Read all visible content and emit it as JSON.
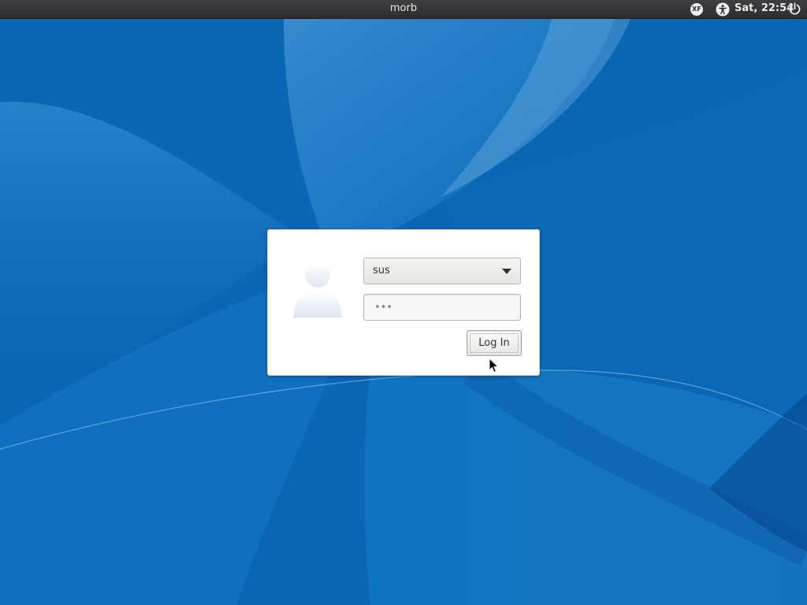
{
  "panel": {
    "hostname": "morb",
    "keyboard_indicator": "XF",
    "clock": "Sat, 22:54",
    "icons": {
      "keyboard": "keyboard-layout-icon",
      "accessibility": "accessibility-icon",
      "power": "power-icon"
    }
  },
  "login": {
    "selected_user": "sus",
    "password_value": "•••",
    "login_button": "Log In",
    "avatar": "user-avatar-icon"
  },
  "colors": {
    "panel_bg": "#2f3133",
    "wallpaper_primary": "#0b6fc0",
    "dialog_bg": "#ffffff"
  }
}
